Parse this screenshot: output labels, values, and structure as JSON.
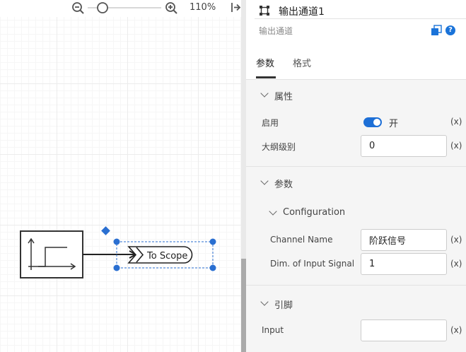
{
  "toolbar": {
    "zoom_value": "110%"
  },
  "diagram": {
    "to_scope_label": "To Scope"
  },
  "panel": {
    "title": "输出通道1",
    "block_type": "输出通道",
    "help_glyph": "?",
    "tabs": [
      {
        "label": "参数",
        "active": true
      },
      {
        "label": "格式",
        "active": false
      }
    ],
    "sections": {
      "attributes": {
        "title": "属性",
        "enable_label": "启用",
        "enable_state_text": "开",
        "enable_on": true,
        "outline_level_label": "大纲级别",
        "outline_level_value": "0"
      },
      "parameters": {
        "title": "参数",
        "configuration": {
          "title": "Configuration",
          "channel_name_label": "Channel Name",
          "channel_name_value": "阶跃信号",
          "dim_label": "Dim. of Input Signal",
          "dim_value": "1"
        }
      },
      "pins": {
        "title": "引脚",
        "input_label": "Input",
        "input_value": ""
      }
    },
    "expression_button": "(x)"
  },
  "colors": {
    "accent": "#1d6fd6",
    "selection": "#2a6fd1",
    "panel_bg": "#f5f5f5"
  }
}
